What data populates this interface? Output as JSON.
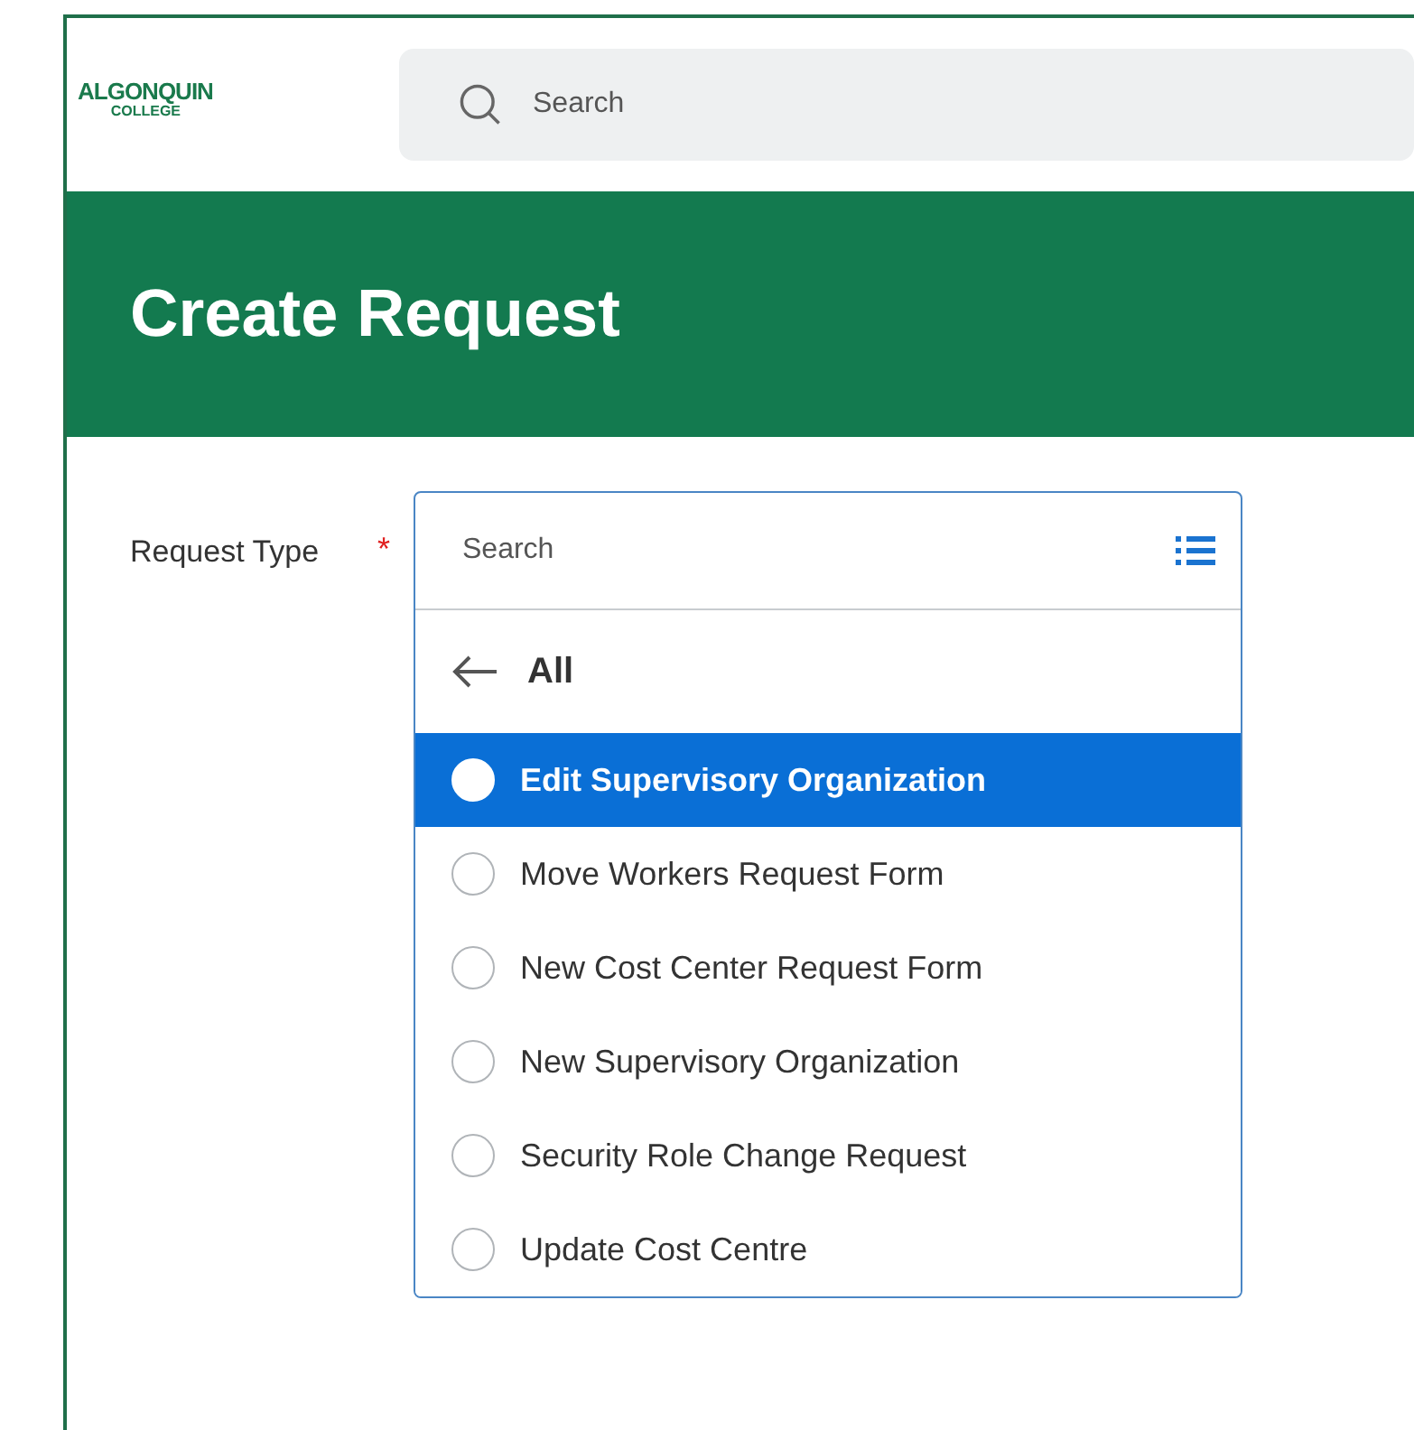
{
  "header": {
    "logo": {
      "line_1": "ALGONQUIN",
      "line_2": "COLLEGE"
    },
    "search": {
      "placeholder": "Search"
    }
  },
  "banner": {
    "title": "Create Request"
  },
  "form": {
    "label": "Request Type",
    "required": true,
    "required_mark": "*",
    "field": {
      "placeholder": "Search"
    },
    "dropdown": {
      "back_label": "All",
      "options": [
        {
          "label": "Edit Supervisory Organization",
          "selected": true
        },
        {
          "label": "Move Workers Request Form",
          "selected": false
        },
        {
          "label": "New Cost Center Request Form",
          "selected": false
        },
        {
          "label": "New Supervisory Organization",
          "selected": false
        },
        {
          "label": "Security Role Change Request",
          "selected": false
        },
        {
          "label": "Update Cost Centre",
          "selected": false
        }
      ]
    }
  }
}
